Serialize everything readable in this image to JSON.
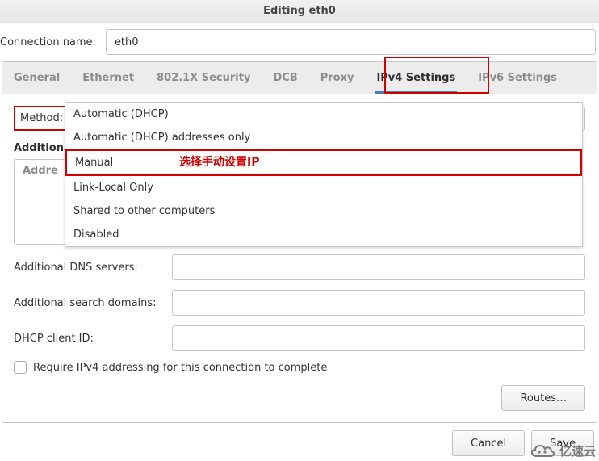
{
  "window": {
    "title": "Editing eth0"
  },
  "connection": {
    "label": "Connection name:",
    "value": "eth0"
  },
  "tabs": [
    {
      "label": "General"
    },
    {
      "label": "Ethernet"
    },
    {
      "label": "802.1X Security"
    },
    {
      "label": "DCB"
    },
    {
      "label": "Proxy"
    },
    {
      "label": "IPv4 Settings",
      "active": true
    },
    {
      "label": "IPv6 Settings"
    }
  ],
  "method": {
    "label": "Method:"
  },
  "dropdown": {
    "options": [
      "Automatic (DHCP)",
      "Automatic (DHCP) addresses only",
      "Manual",
      "Link-Local Only",
      "Shared to other computers",
      "Disabled"
    ],
    "annotation": "选择手动设置IP"
  },
  "addresses": {
    "heading": "Additiona",
    "col1": "Addre"
  },
  "fields": {
    "dns_label": "Additional DNS servers:",
    "dns_value": "",
    "search_label": "Additional search domains:",
    "search_value": "",
    "dhcp_label": "DHCP client ID:",
    "dhcp_value": "",
    "require_label": "Require IPv4 addressing for this connection to complete"
  },
  "buttons": {
    "routes": "Routes…",
    "cancel": "Cancel",
    "save": "Save"
  },
  "watermark": {
    "text": "亿速云"
  }
}
